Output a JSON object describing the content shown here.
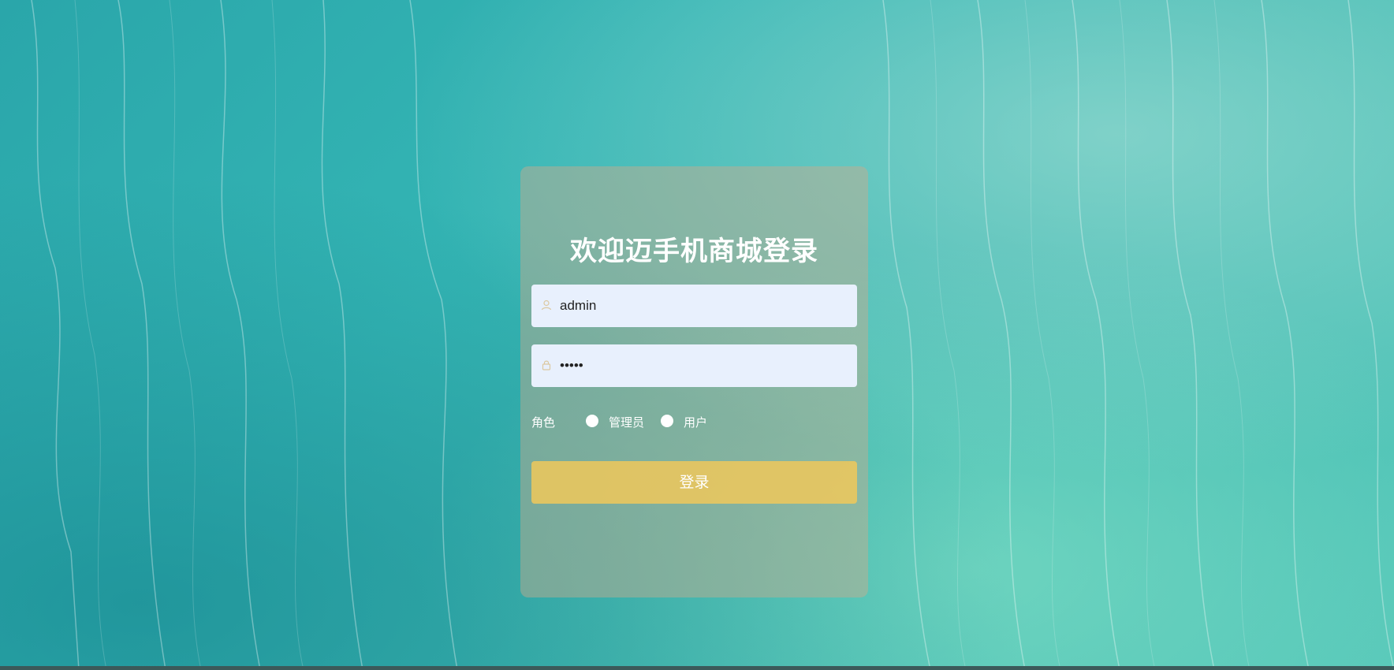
{
  "login": {
    "title": "欢迎迈手机商城登录",
    "username": {
      "value": "admin",
      "icon": "user-icon"
    },
    "password": {
      "value": "admin",
      "icon": "lock-icon"
    },
    "role": {
      "label": "角色",
      "options": [
        "管理员",
        "用户"
      ]
    },
    "submit_label": "登录"
  },
  "colors": {
    "card_bg": "#CDAA8C",
    "input_bg": "#E8F0FD",
    "button_bg": "#F0C85A",
    "text": "#FFFFFF"
  }
}
